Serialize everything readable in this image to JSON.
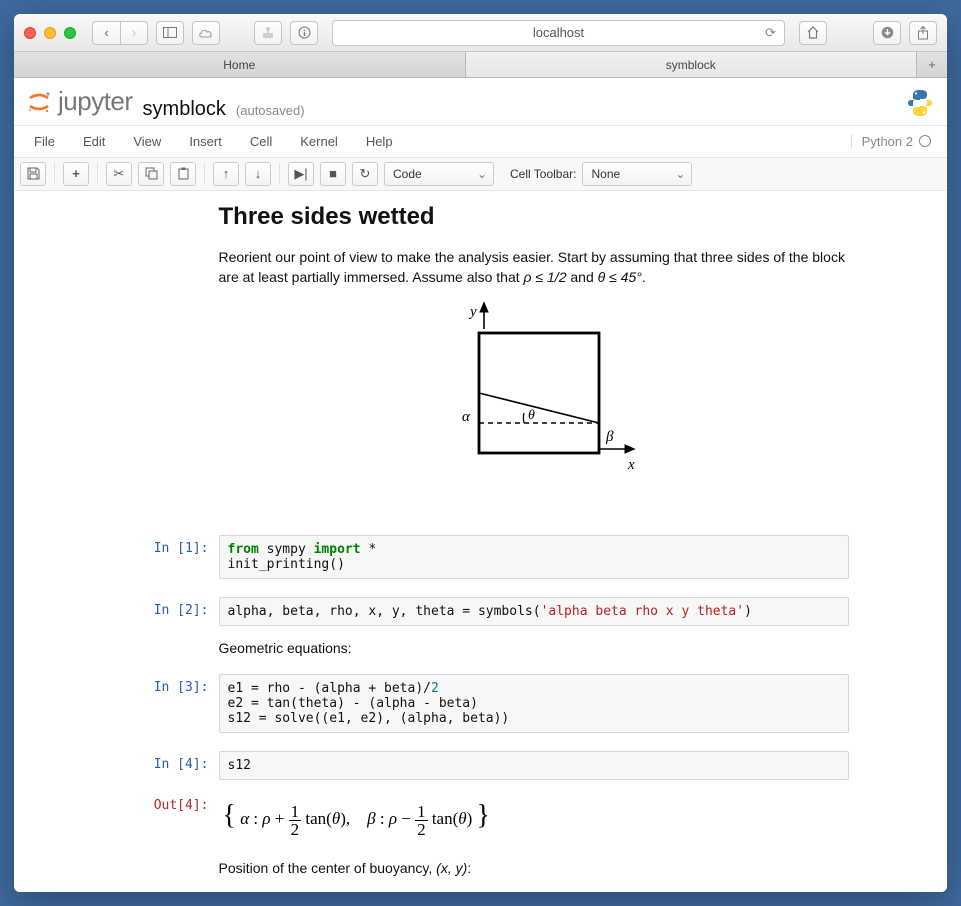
{
  "browser": {
    "url": "localhost",
    "tabs": [
      {
        "label": "Home"
      },
      {
        "label": "symblock"
      }
    ]
  },
  "notebook": {
    "brand": "jupyter",
    "name": "symblock",
    "savestate": "(autosaved)",
    "kernel": "Python 2",
    "menus": [
      "File",
      "Edit",
      "View",
      "Insert",
      "Cell",
      "Kernel",
      "Help"
    ],
    "toolbar": {
      "cell_type": "Code",
      "cell_toolbar_label": "Cell Toolbar:",
      "cell_toolbar_value": "None"
    },
    "markdown": {
      "title": "Three sides wetted",
      "para1_a": "Reorient our point of view to make the analysis easier. Start by assuming that three sides of the block are at least partially immersed. Assume also that ",
      "para1_b": " and ",
      "cond1": "ρ ≤ 1/2",
      "cond2": "θ ≤ 45°",
      "geo_label": "Geometric equations:",
      "pos_label_a": "Position of the center of buoyancy, ",
      "pos_label_b": "(x, y)",
      "pos_label_c": ":"
    },
    "diagram": {
      "x": "x",
      "y": "y",
      "alpha": "α",
      "beta": "β",
      "theta": "θ"
    },
    "cells": [
      {
        "in": "In [1]:",
        "code_html": "<span class='kw-blue'>from</span> sympy <span class='kw-blue'>import</span> *\ninit_printing()"
      },
      {
        "in": "In [2]:",
        "code_html": "alpha, beta, rho, x, y, theta = symbols(<span class='str'>'alpha beta rho x y theta'</span>)"
      },
      {
        "in": "In [3]:",
        "code_html": "e1 = rho - (alpha + beta)/<span class='num'>2</span>\ne2 = tan(theta) - (alpha - beta)\ns12 = solve((e1, e2), (alpha, beta))"
      },
      {
        "in": "In [4]:",
        "out": "Out[4]:",
        "code_html": "s12",
        "output_latex": "{ α : ρ + ½ tan(θ),   β : ρ − ½ tan(θ) }"
      }
    ]
  }
}
